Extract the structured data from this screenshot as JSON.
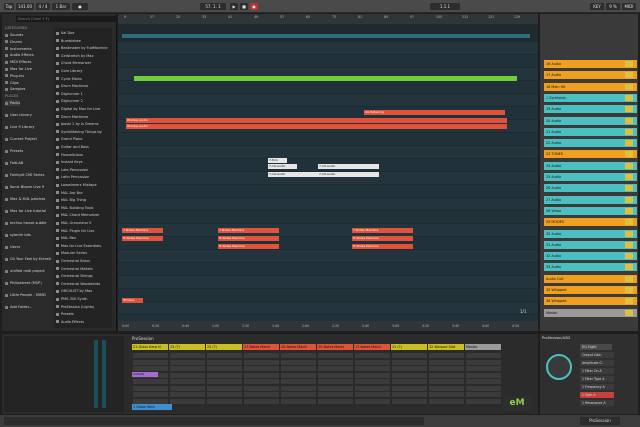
{
  "topbar": {
    "tap": "Tap",
    "tempo": "141.00",
    "signature": "4 / 4",
    "quantize": "1 Bar",
    "position": "57. 1. 1",
    "key_midi": "KEY",
    "cpu": "9 %"
  },
  "browser": {
    "search_placeholder": "Search (Cmd + F)",
    "categories_title": "CATEGORIES",
    "categories": [
      "Sounds",
      "Drums",
      "Instruments",
      "Audio Effects",
      "MIDI Effects",
      "Max for Live",
      "Plug-ins",
      "Clips",
      "Samples"
    ],
    "places_title": "PLACES",
    "places": [
      "Packs",
      "User Library",
      "Live 9 Library",
      "Current Project",
      "Presets",
      "FaitLAB",
      "Fairlight CMI Series",
      "Sonic Bloom Live 9",
      "Max & M4L patches",
      "Max for Live tutorial",
      "techno house subtle",
      "sylenth bits",
      "Users",
      "Cit Your Feel by Entrait",
      "unified midi project",
      "Philipstreet (MSP)",
      "Little People - MIMD",
      "Add Folder..."
    ],
    "files": [
      "Kai Doe",
      "Bumblebee",
      "Beatmaker by FudMachine",
      "Cellstretch by Max",
      "Chord Memorizer",
      "Core Library",
      "Cycle Mains",
      "Drum Machines",
      "Digirunner 1",
      "Digirunner 2",
      "Digital by Max for Live",
      "Drum Machines",
      "Jooski 2 by Is Dreams",
      "SynthMaking Things by",
      "Grand Piano",
      "Guitar and Bass",
      "Houselicious",
      "Instant Keys",
      "Late Percussion",
      "Latin Percussion",
      "Lowwinners Mixtape",
      "MAL Arp Bro",
      "MAL Big Thing",
      "MAL Building Tools",
      "MAL Chord Memorizer",
      "MAL Granulator II",
      "MAL Plugin for Live",
      "MAL Rev",
      "Max for Live Essentials",
      "Modular Series",
      "Orchestral Brass",
      "Orchestral Mallets",
      "Orchestral Strings",
      "Orchestral Woodwinds",
      "ORCHLIST by Max",
      "PMS-300 Synth",
      "ProSession (Lights)",
      "Presets",
      "Audio Effects"
    ]
  },
  "arrangement": {
    "ruler_marks": [
      "9",
      "17",
      "25",
      "33",
      "41",
      "49",
      "57",
      "65",
      "73",
      "81",
      "89",
      "97",
      "105",
      "113",
      "121",
      "129"
    ],
    "timeline_marks": [
      "0:00",
      "0:20",
      "0:40",
      "1:00",
      "1:20",
      "1:40",
      "2:00",
      "2:20",
      "2:40",
      "3:00",
      "3:20",
      "3:40",
      "4:00",
      "4:20"
    ],
    "zoom": "1/1",
    "clips": [
      {
        "label": "",
        "color": "green",
        "lane": 0
      },
      {
        "label": "44-Fattening",
        "color": "red",
        "lane": 1
      },
      {
        "label": "Windup Audio",
        "color": "red",
        "lane": 2
      },
      {
        "label": "Windup Audio",
        "color": "red",
        "lane": 3
      },
      {
        "label": "7-Tom",
        "color": "white",
        "lane": 4
      },
      {
        "label": "7-19-Audio",
        "color": "white",
        "lane": 5
      },
      {
        "label": "7-19-Audio",
        "color": "white",
        "lane": 6
      },
      {
        "label": "7-Notes Machine",
        "color": "red",
        "lane": 7
      },
      {
        "label": "Tr-Notes Machine",
        "color": "red",
        "lane": 8
      },
      {
        "label": "Windup",
        "color": "red",
        "lane": 9
      }
    ]
  },
  "tracks": [
    {
      "name": "16 Audio",
      "color": "#f0a020"
    },
    {
      "name": "17 Audio",
      "color": "#f0a020"
    },
    {
      "name": "18 Main Hit",
      "color": "#f0a020"
    },
    {
      "name": "1 Synthesis",
      "color": "#4cc0c0"
    },
    {
      "name": "19 Audio",
      "color": "#4cc0c0"
    },
    {
      "name": "20 Audio",
      "color": "#4cc0c0"
    },
    {
      "name": "21 Audio",
      "color": "#4cc0c0"
    },
    {
      "name": "22 Audio",
      "color": "#4cc0c0"
    },
    {
      "name": "23 TONES",
      "color": "#f0a020"
    },
    {
      "name": "24 Audio",
      "color": "#4cc0c0"
    },
    {
      "name": "25 Audio",
      "color": "#4cc0c0"
    },
    {
      "name": "26 Audio",
      "color": "#4cc0c0"
    },
    {
      "name": "27 Audio",
      "color": "#4cc0c0"
    },
    {
      "name": "28 Whoa",
      "color": "#4cc0c0"
    },
    {
      "name": "29 MODES",
      "color": "#f0a020"
    },
    {
      "name": "30 Audio",
      "color": "#4cc0c0"
    },
    {
      "name": "31 Audio",
      "color": "#4cc0c0"
    },
    {
      "name": "32 Audio",
      "color": "#4cc0c0"
    },
    {
      "name": "33 Audio",
      "color": "#4cc0c0"
    },
    {
      "name": "Audio Cult",
      "color": "#f0a020"
    },
    {
      "name": "35 Whipped",
      "color": "#f0a020"
    },
    {
      "name": "36 Whipped",
      "color": "#f0a020"
    },
    {
      "name": "Master",
      "color": "#9a9a9a"
    }
  ],
  "session": {
    "title": "ProSession",
    "columns": [
      {
        "name": "21-Glass Harp N",
        "color": "#c9c020"
      },
      {
        "name": "23 (?)",
        "color": "#c9c020"
      },
      {
        "name": "23 (?)",
        "color": "#c9c020"
      },
      {
        "name": "17-Notes Machi",
        "color": "#e0523a"
      },
      {
        "name": "26-Notes Machi",
        "color": "#e0523a"
      },
      {
        "name": "29-Notes Machi",
        "color": "#e0523a"
      },
      {
        "name": "17-Notes Machi",
        "color": "#e0523a"
      },
      {
        "name": "31 (?)",
        "color": "#c9c020"
      },
      {
        "name": "32 Warpod Stat",
        "color": "#c9c020"
      },
      {
        "name": "Master",
        "color": "#9a9a9a"
      }
    ],
    "clip_row_label": "Auto(8)",
    "bottom_clip": "1 Glass Harp",
    "logo": "eM"
  },
  "device": {
    "title": "ProSession/ASD",
    "params": [
      "Output Gain",
      "Amplitude G.",
      "1 Filter On A",
      "1 Filter Type A",
      "1 Frequency A",
      "1 Gain A",
      "1 Resonance A"
    ],
    "fx_label": "EQ Eight"
  },
  "statusbar": {
    "left": "",
    "right": "ProSession"
  }
}
